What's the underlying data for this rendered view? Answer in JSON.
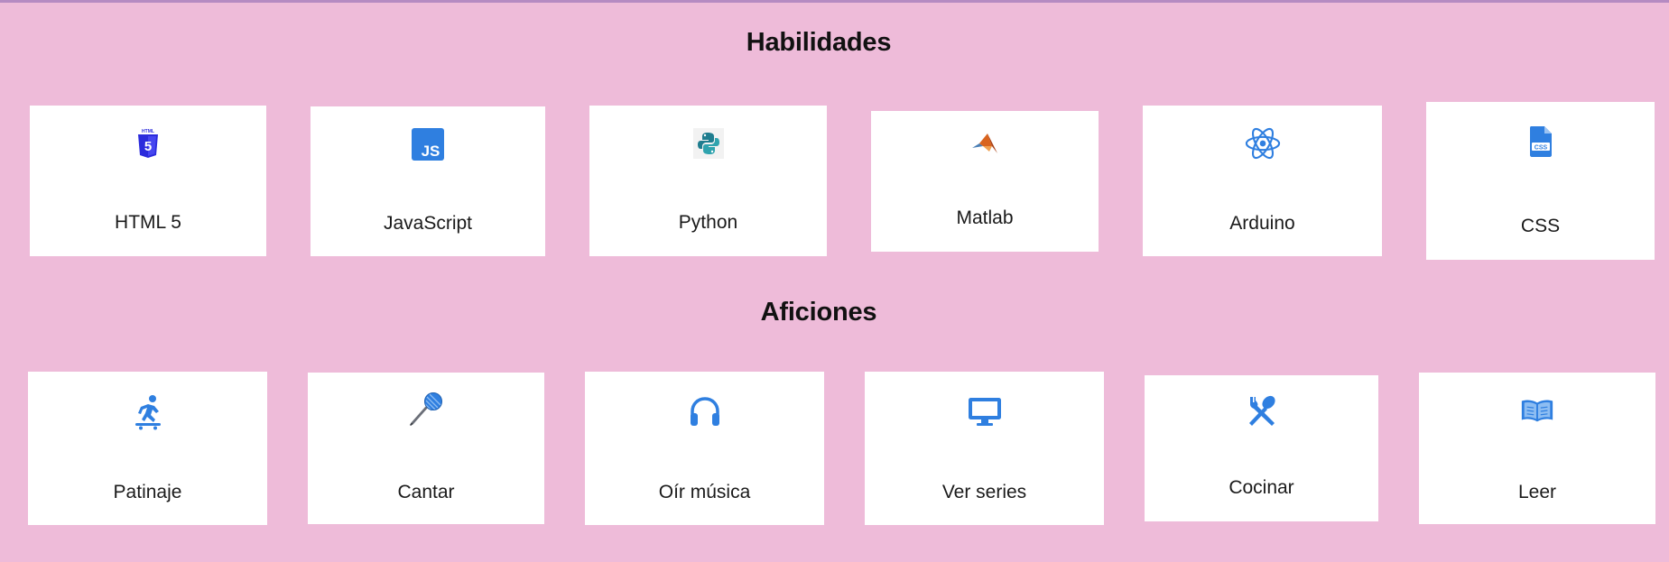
{
  "skills": {
    "title": "Habilidades",
    "items": [
      {
        "label": "HTML 5",
        "icon": "html5-icon"
      },
      {
        "label": "JavaScript",
        "icon": "javascript-icon"
      },
      {
        "label": "Python",
        "icon": "python-icon"
      },
      {
        "label": "Matlab",
        "icon": "matlab-icon"
      },
      {
        "label": "Arduino",
        "icon": "react-atom-icon"
      },
      {
        "label": "CSS",
        "icon": "css-file-icon"
      }
    ]
  },
  "hobbies": {
    "title": "Aficiones",
    "items": [
      {
        "label": "Patinaje",
        "icon": "skateboarding-icon"
      },
      {
        "label": "Cantar",
        "icon": "microphone-icon"
      },
      {
        "label": "Oír música",
        "icon": "headphones-icon"
      },
      {
        "label": "Ver series",
        "icon": "monitor-icon"
      },
      {
        "label": "Cocinar",
        "icon": "utensils-icon"
      },
      {
        "label": "Leer",
        "icon": "open-book-icon"
      }
    ]
  },
  "colors": {
    "background": "#eebbd9",
    "card": "#ffffff",
    "icon_blue": "#2f7fe0"
  }
}
